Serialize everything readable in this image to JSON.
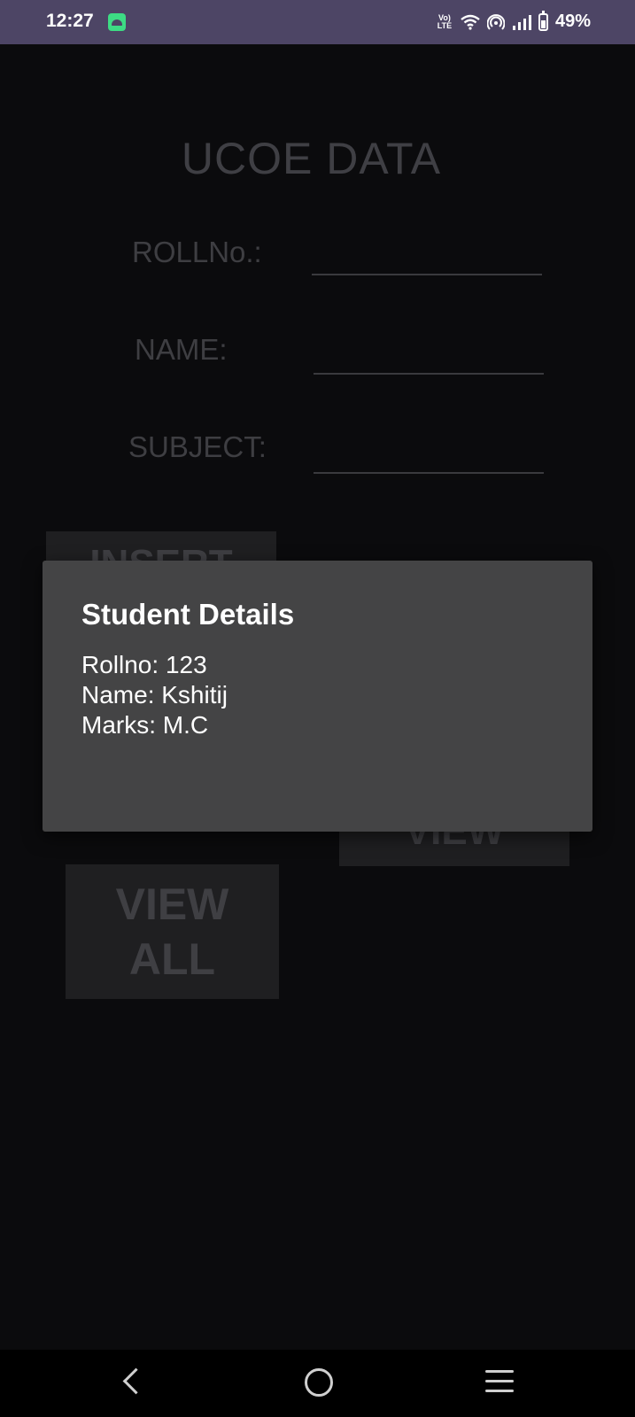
{
  "status_bar": {
    "time": "12:27",
    "network_label": "Vo) LTE",
    "battery_percent": "49%",
    "background_color": "#4d4565"
  },
  "app": {
    "title": "UCOE DATA",
    "fields": {
      "roll_label": "ROLLNo.:",
      "name_label": "NAME:",
      "subject_label": "SUBJECT:"
    },
    "buttons": {
      "insert_label": "INSERT",
      "view_label": "VIEW",
      "view_all_line1": "VIEW",
      "view_all_line2": "ALL"
    }
  },
  "dialog": {
    "title": "Student Details",
    "lines": [
      "Rollno: 123",
      "Name: Kshitij",
      "Marks: M.C"
    ]
  },
  "icons": [
    "android-icon",
    "volte-icon",
    "wifi-icon",
    "hotspot-icon",
    "signal-icon",
    "battery-icon",
    "back-icon",
    "home-icon",
    "menu-icon"
  ]
}
